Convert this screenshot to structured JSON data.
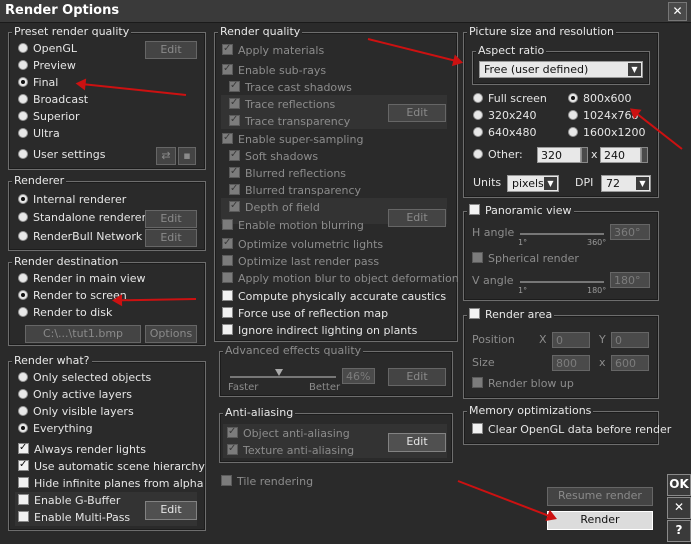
{
  "window": {
    "title": "Render Options",
    "close": "✕"
  },
  "preset": {
    "legend": "Preset render quality",
    "items": [
      "OpenGL",
      "Preview",
      "Final",
      "Broadcast",
      "Superior",
      "Ultra",
      "User settings"
    ],
    "edit": "Edit"
  },
  "renderer": {
    "legend": "Renderer",
    "items": [
      "Internal renderer",
      "Standalone renderer",
      "RenderBull Network"
    ],
    "edit": "Edit"
  },
  "destination": {
    "legend": "Render destination",
    "items": [
      "Render in main view",
      "Render to screen",
      "Render to disk"
    ],
    "path": "C:\\...\\tut1.bmp",
    "options": "Options"
  },
  "what": {
    "legend": "Render what?",
    "radios": [
      "Only selected objects",
      "Only active layers",
      "Only visible layers",
      "Everything"
    ],
    "checks": [
      "Always render lights",
      "Use automatic scene hierarchy",
      "Hide infinite planes from alpha",
      "Enable G-Buffer",
      "Enable Multi-Pass"
    ],
    "edit": "Edit"
  },
  "quality": {
    "legend": "Render quality",
    "items": [
      "Apply materials",
      "Enable sub-rays",
      "Trace cast shadows",
      "Trace reflections",
      "Trace transparency",
      "Enable super-sampling",
      "Soft shadows",
      "Blurred reflections",
      "Blurred transparency",
      "Depth of field",
      "Enable motion blurring",
      "Optimize volumetric lights",
      "Optimize last render pass",
      "Apply motion blur to object deformation",
      "Compute physically accurate caustics",
      "Force use of reflection map",
      "Ignore indirect lighting on plants"
    ],
    "edit": "Edit"
  },
  "advanced": {
    "legend": "Advanced effects quality",
    "faster": "Faster",
    "better": "Better",
    "value": "46%",
    "level": 0.46,
    "edit": "Edit"
  },
  "antialias": {
    "legend": "Anti-aliasing",
    "items": [
      "Object anti-aliasing",
      "Texture anti-aliasing"
    ],
    "edit": "Edit"
  },
  "tile": "Tile rendering",
  "picture": {
    "legend": "Picture size and resolution",
    "aspect_legend": "Aspect ratio",
    "aspect_value": "Free (user defined)",
    "sizes": [
      "Full screen",
      "800x600",
      "320x240",
      "1024x768",
      "640x480",
      "1600x1200"
    ],
    "other": "Other:",
    "width": "320",
    "x": "x",
    "height": "240",
    "units_label": "Units",
    "units": "pixels",
    "dpi_label": "DPI",
    "dpi": "72"
  },
  "panoramic": {
    "legend": "Panoramic view",
    "h_angle": "H angle",
    "h_min": "1°",
    "h_max": "360°",
    "h_value": "360°",
    "spherical": "Spherical render",
    "v_angle": "V angle",
    "v_min": "1°",
    "v_max": "180°",
    "v_value": "180°"
  },
  "area": {
    "legend": "Render area",
    "position": "Position",
    "x": "X",
    "x_val": "0",
    "y": "Y",
    "y_val": "0",
    "size": "Size",
    "w_val": "800",
    "sx": "x",
    "h_val": "600",
    "blowup": "Render blow up"
  },
  "memory": {
    "legend": "Memory optimizations",
    "item": "Clear OpenGL data before render"
  },
  "actions": {
    "resume": "Resume render",
    "render": "Render"
  },
  "side": {
    "ok": "OK",
    "cancel": "✕",
    "help": "?"
  }
}
